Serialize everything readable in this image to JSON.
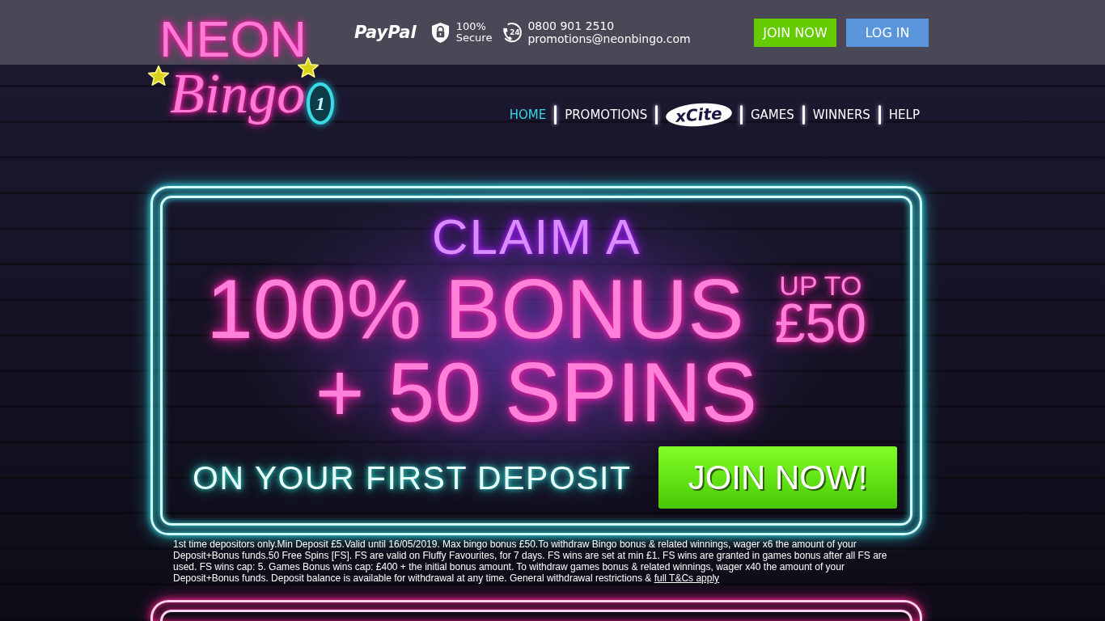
{
  "header": {
    "logo": {
      "line_1": "NEON",
      "line_2": "Bingo",
      "ball_number": "1"
    },
    "payment_logo": "PayPal",
    "security_badge": "100% Secure",
    "contact": {
      "hours_badge": "24",
      "phone": "0800 901 2510",
      "email": "promotions@neonbingo.com"
    },
    "buttons": [
      {
        "label": "JOIN NOW",
        "kind": "join"
      },
      {
        "label": "LOG IN",
        "kind": "login"
      }
    ]
  },
  "nav": [
    {
      "label": "HOME",
      "kind": "text",
      "selected": true
    },
    {
      "label": "PROMOTIONS",
      "kind": "text",
      "selected": false
    },
    {
      "label": "xCite",
      "kind": "logo",
      "selected": false
    },
    {
      "label": "GAMES",
      "kind": "text",
      "selected": false
    },
    {
      "label": "WINNERS",
      "kind": "text",
      "selected": false
    },
    {
      "label": "HELP",
      "kind": "text",
      "selected": false
    }
  ],
  "hero": {
    "headline_1": "CLAIM A",
    "headline_2": "100% BONUS",
    "bonus_cap": {
      "line_1": "UP TO",
      "line_2": "£50"
    },
    "headline_3": "+ 50 SPINS",
    "subline": "ON YOUR FIRST DEPOSIT",
    "button": "JOIN NOW!"
  },
  "terms": {
    "text": "1st time depositors only.Min Deposit £5.Valid until 16/05/2019. Max bingo bonus £50.To withdraw Bingo bonus & related winnings, wager x6 the amount of your Deposit+Bonus funds.50 Free Spins [FS]. FS are valid on Fluffy Favourites, for 7 days. FS wins are set at min £1. FS wins are granted in games bonus after all FS are used. FS wins cap: 5. Games Bonus wins cap: £400 + the initial bonus amount. To withdraw games bonus & related winnings, wager x40 the amount of your Deposit+Bonus funds. Deposit balance is available for withdrawal at any time. General withdrawal restrictions &",
    "link": "full T&Cs apply"
  }
}
